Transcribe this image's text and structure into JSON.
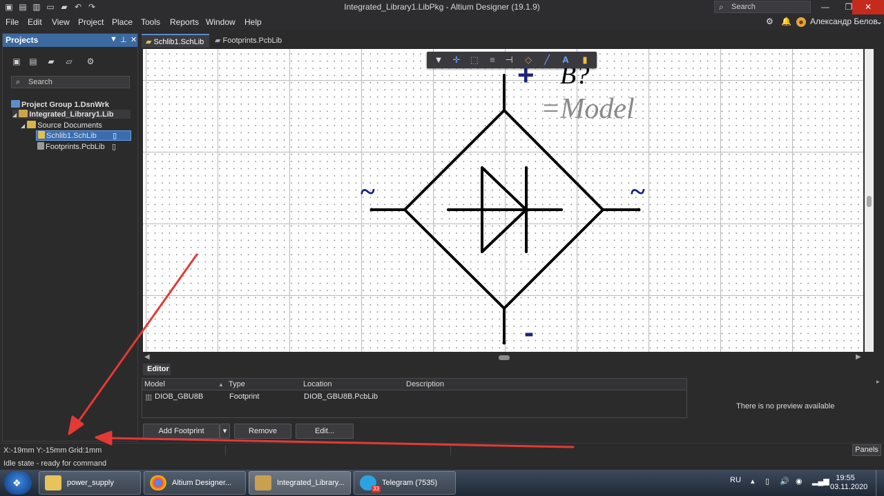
{
  "window": {
    "title": "Integrated_Library1.LibPkg - Altium Designer (19.1.9)",
    "search_placeholder": "Search",
    "minimize": "—",
    "maximize": "❐",
    "close": "✕"
  },
  "menu": {
    "items": [
      "File",
      "Edit",
      "View",
      "Project",
      "Place",
      "Tools",
      "Reports",
      "Window",
      "Help"
    ],
    "user_name": "Александр Белов"
  },
  "projects_panel": {
    "title": "Projects",
    "search_placeholder": "Search",
    "tree": {
      "group": "Project Group 1.DsnWrk",
      "project": "Integrated_Library1.Lib",
      "folder": "Source Documents",
      "doc1": "Schlib1.SchLib",
      "doc2": "Footprints.PcbLib"
    }
  },
  "tabs": [
    "Schlib1.SchLib",
    "Footprints.PcbLib"
  ],
  "symbol": {
    "designator": "B?",
    "comment": "=Model",
    "pin_ac": "~",
    "pin_plus": "+",
    "pin_minus": "-"
  },
  "colors": {
    "accent": "#3c6aa0",
    "pin_label": "#1a237e",
    "arrow": "#e53935",
    "selection": "#3a6db0"
  },
  "editor": {
    "tab_label": "Editor",
    "columns": [
      "Model",
      "Type",
      "Location",
      "Description"
    ],
    "rows": [
      {
        "model": "DIOB_GBU8B",
        "type": "Footprint",
        "location": "DIOB_GBU8B.PcbLib",
        "description": ""
      }
    ],
    "preview_text": "There is no preview available",
    "buttons": {
      "add_footprint": "Add Footprint",
      "remove": "Remove",
      "edit": "Edit..."
    }
  },
  "status": {
    "coordinates": "X:-19mm Y:-15mm",
    "grid": "Grid:1mm",
    "message": "Idle state - ready for command",
    "panels_button": "Panels"
  },
  "taskbar": {
    "tasks": [
      "power_supply",
      "Altium Designer...",
      "Integrated_Library...",
      "Telegram (7535)"
    ],
    "telegram_badge": "33",
    "language": "RU",
    "time": "19:55",
    "date": "03.11.2020"
  }
}
